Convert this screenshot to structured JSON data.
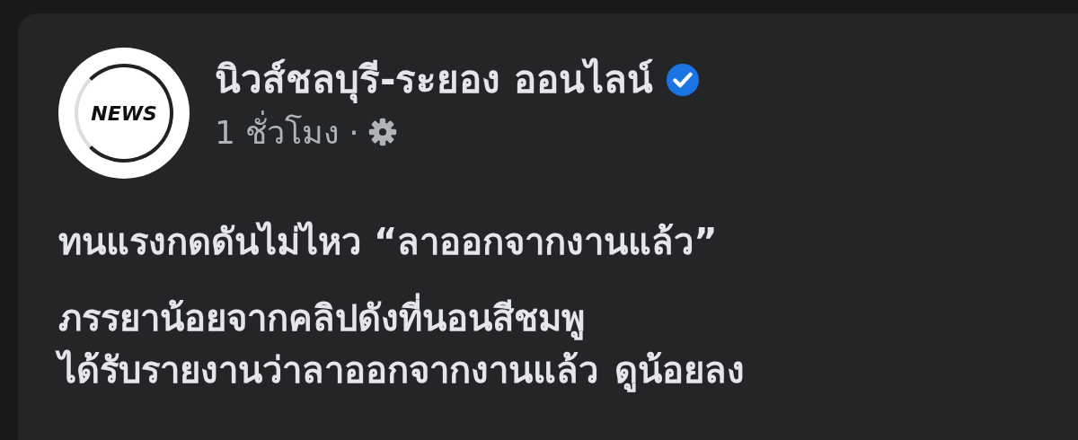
{
  "post": {
    "author": "นิวส์ชลบุรี-ระยอง ออนไลน์",
    "verified": true,
    "avatar": {
      "logo_text": "NEWS"
    },
    "time": "1 ชั่วโมง",
    "separator": "·",
    "headline": "ทนแรงกดดันไม่ไหว “ลาออกจากงานแล้ว”",
    "lines": [
      "ภรรยาน้อยจากคลิปดังที่นอนสีชมพู",
      "ได้รับรายงานว่าลาออกจากงานแล้ว"
    ],
    "see_less": "ดูน้อยลง"
  }
}
